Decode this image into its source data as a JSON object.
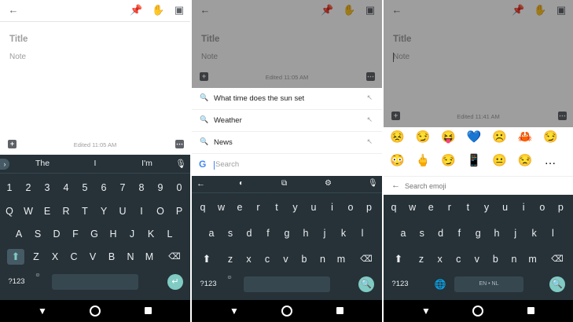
{
  "keep": {
    "title_placeholder": "Title",
    "note_placeholder": "Note"
  },
  "panel1": {
    "edited": "Edited 11:05 AM",
    "suggestions": [
      "The",
      "I",
      "I'm"
    ],
    "row_numbers": [
      "1",
      "2",
      "3",
      "4",
      "5",
      "6",
      "7",
      "8",
      "9",
      "0"
    ],
    "row_q": [
      "Q",
      "W",
      "E",
      "R",
      "T",
      "Y",
      "U",
      "I",
      "O",
      "P"
    ],
    "row_a": [
      "A",
      "S",
      "D",
      "F",
      "G",
      "H",
      "J",
      "K",
      "L"
    ],
    "row_z": [
      "Z",
      "X",
      "C",
      "V",
      "B",
      "N",
      "M"
    ],
    "symbols_label": "?123"
  },
  "panel2": {
    "edited": "Edited 11:05 AM",
    "search_results": [
      "What time does the sun set",
      "Weather",
      "News"
    ],
    "search_placeholder": "Search",
    "row_q": [
      "q",
      "w",
      "e",
      "r",
      "t",
      "y",
      "u",
      "i",
      "o",
      "p"
    ],
    "row_a": [
      "a",
      "s",
      "d",
      "f",
      "g",
      "h",
      "j",
      "k",
      "l"
    ],
    "row_z": [
      "z",
      "x",
      "c",
      "v",
      "b",
      "n",
      "m"
    ],
    "symbols_label": "?123"
  },
  "panel3": {
    "edited": "Edited 11:41 AM",
    "emoji_placeholder": "Search emoji",
    "emoji_row1": [
      "😣",
      "😏",
      "😝",
      "💙",
      "☹️",
      "🦀",
      "😏"
    ],
    "emoji_row2": [
      "😳",
      "🖕",
      "😏",
      "📱",
      "😐",
      "😒",
      "…"
    ],
    "row_q": [
      "q",
      "w",
      "e",
      "r",
      "t",
      "y",
      "u",
      "i",
      "o",
      "p"
    ],
    "row_a": [
      "a",
      "s",
      "d",
      "f",
      "g",
      "h",
      "j",
      "k",
      "l"
    ],
    "row_z": [
      "z",
      "x",
      "c",
      "v",
      "b",
      "n",
      "m"
    ],
    "symbols_label": "?123",
    "language_label": "EN • NL"
  },
  "icons": {
    "back": "arrow-left-icon",
    "pin": "pin-icon",
    "reminder": "hand-reminder-icon",
    "archive": "archive-icon",
    "search": "search-icon",
    "enter": "enter-icon",
    "backspace": "backspace-icon",
    "shift": "shift-icon",
    "globe": "globe-icon",
    "mic": "mic-icon"
  },
  "colors": {
    "keyboard_bg": "#263238",
    "accent": "#80cbc4",
    "key_text": "#eceff1",
    "dim_overlay": "rgba(0,0,0,0.38)"
  }
}
